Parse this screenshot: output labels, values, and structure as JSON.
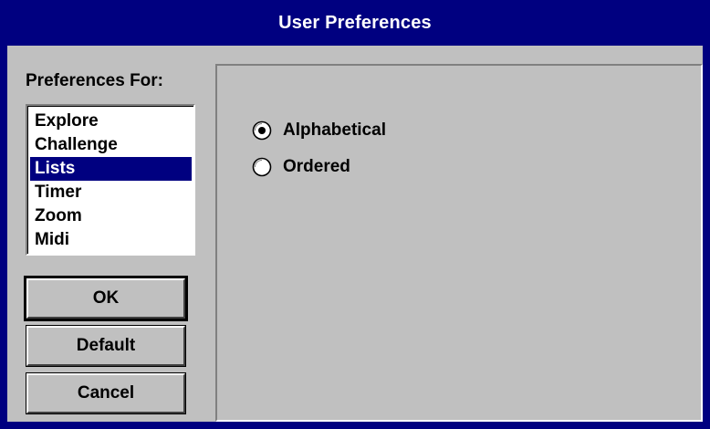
{
  "window": {
    "title": "User Preferences"
  },
  "preferences": {
    "label": "Preferences For:",
    "items": [
      {
        "label": "Explore"
      },
      {
        "label": "Challenge"
      },
      {
        "label": "Lists",
        "selected": true
      },
      {
        "label": "Timer"
      },
      {
        "label": "Zoom"
      },
      {
        "label": "Midi"
      }
    ],
    "selected_item": "Lists"
  },
  "buttons": {
    "ok": "OK",
    "default": "Default",
    "cancel": "Cancel"
  },
  "list_options": {
    "alphabetical": {
      "label": "Alphabetical",
      "checked": true
    },
    "ordered": {
      "label": "Ordered",
      "checked": false
    }
  },
  "colors": {
    "titlebar": "#000080",
    "face": "#c0c0c0",
    "selection": "#000080"
  }
}
